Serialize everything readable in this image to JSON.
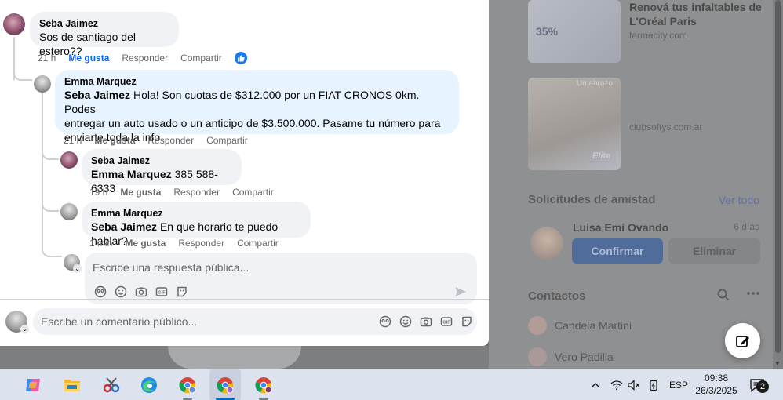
{
  "sidebar": {
    "ad1": {
      "sale": "35%",
      "title": "Renová tus infaltables de L'Oréal Paris",
      "domain": "farmacity.com"
    },
    "ad2": {
      "tag": "Un abrazo",
      "brand": "Elite",
      "domain": "clubsoftys.com.ar"
    },
    "friend_requests": {
      "heading": "Solicitudes de amistad",
      "see_all": "Ver todo",
      "request": {
        "name": "Luisa Emi Ovando",
        "time": "6 días",
        "confirm": "Confirmar",
        "delete": "Eliminar"
      }
    },
    "contacts": {
      "heading": "Contactos",
      "items": [
        {
          "name": "Candela Martini"
        },
        {
          "name": "Vero Padilla"
        }
      ]
    }
  },
  "comments": {
    "c1": {
      "author": "Seba Jaimez",
      "text": "Sos de santiago del estero??",
      "time": "21 h",
      "like": "Me gusta",
      "reply": "Responder",
      "share": "Compartir"
    },
    "c2": {
      "author": "Emma Marquez",
      "mention": "Seba Jaimez",
      "text_line1": " Hola! Son cuotas de $312.000 por un FIAT CRONOS 0km. Podes",
      "text_line2": "entregar un auto usado o un anticipo de $3.500.000. Pasame tu número para",
      "text_line3": "enviarte toda la info",
      "time": "21 h",
      "like": "Me gusta",
      "reply": "Responder",
      "share": "Compartir"
    },
    "c3": {
      "author": "Seba Jaimez",
      "mention": "Emma Marquez",
      "text": " 385 588-6333",
      "time": "19 h",
      "like": "Me gusta",
      "reply": "Responder",
      "share": "Compartir"
    },
    "c4": {
      "author": "Emma Marquez",
      "mention": "Seba Jaimez",
      "text": " En que horario te puedo hablar?",
      "time": "1 min",
      "like": "Me gusta",
      "reply": "Responder",
      "share": "Compartir"
    }
  },
  "reply_box": {
    "placeholder": "Escribe una respuesta pública..."
  },
  "comment_box": {
    "placeholder": "Escribe un comentario público..."
  },
  "taskbar": {
    "language": "ESP",
    "time": "09:38",
    "date": "26/3/2025",
    "notifications": "2"
  },
  "colors": {
    "fb_blue": "#0866ff",
    "bubble": "#f0f2f5",
    "highlight_bubble": "#e7f3ff"
  }
}
